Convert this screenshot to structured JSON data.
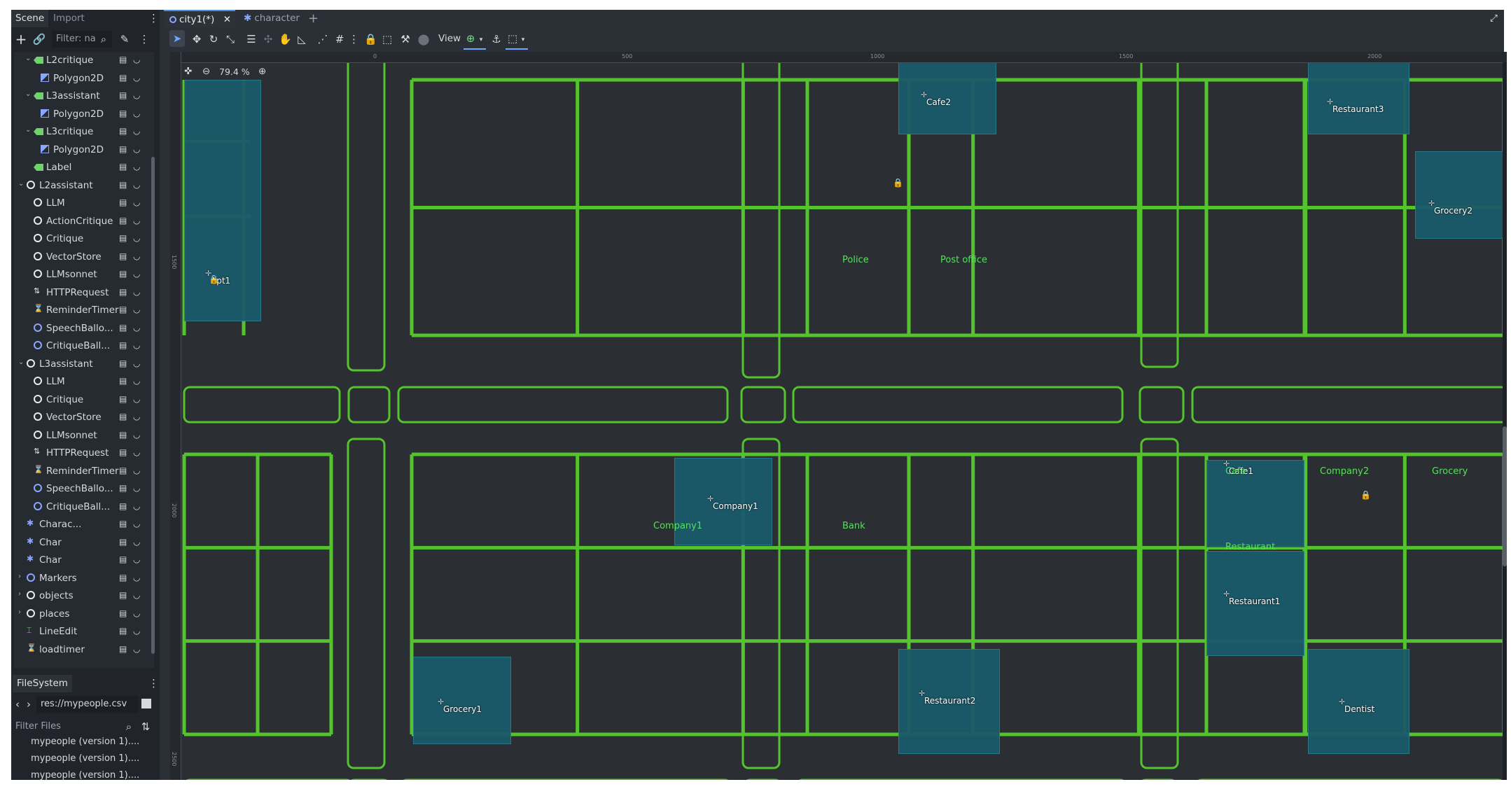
{
  "left_dock": {
    "tabs": [
      "Scene",
      "Import"
    ],
    "filter_placeholder": "Filter: na",
    "tree": [
      {
        "label": "L2critique",
        "depth": 2,
        "arrow": "v",
        "icon": "label-node-icon"
      },
      {
        "label": "Polygon2D",
        "depth": 3,
        "arrow": "",
        "icon": "polygon2d-icon"
      },
      {
        "label": "L3assistant",
        "depth": 2,
        "arrow": "v",
        "icon": "label-node-icon"
      },
      {
        "label": "Polygon2D",
        "depth": 3,
        "arrow": "",
        "icon": "polygon2d-icon"
      },
      {
        "label": "L3critique",
        "depth": 2,
        "arrow": "v",
        "icon": "label-node-icon"
      },
      {
        "label": "Polygon2D",
        "depth": 3,
        "arrow": "",
        "icon": "polygon2d-icon"
      },
      {
        "label": "Label",
        "depth": 2,
        "arrow": "",
        "icon": "label-node-icon"
      },
      {
        "label": "L2assistant",
        "depth": 1,
        "arrow": "v",
        "icon": "node-circle-icon"
      },
      {
        "label": "LLM",
        "depth": 2,
        "arrow": "",
        "icon": "node-circle-icon"
      },
      {
        "label": "ActionCritique",
        "depth": 2,
        "arrow": "",
        "icon": "node-circle-icon"
      },
      {
        "label": "Critique",
        "depth": 2,
        "arrow": "",
        "icon": "node-circle-icon"
      },
      {
        "label": "VectorStore",
        "depth": 2,
        "arrow": "",
        "icon": "node-circle-icon"
      },
      {
        "label": "LLMsonnet",
        "depth": 2,
        "arrow": "",
        "icon": "node-circle-icon"
      },
      {
        "label": "HTTPRequest",
        "depth": 2,
        "arrow": "",
        "icon": "http-icon"
      },
      {
        "label": "ReminderTimer",
        "depth": 2,
        "arrow": "",
        "icon": "timer-icon"
      },
      {
        "label": "SpeechBallo...",
        "depth": 2,
        "arrow": "",
        "icon": "node-circle-blue-icon"
      },
      {
        "label": "CritiqueBall...",
        "depth": 2,
        "arrow": "",
        "icon": "node-circle-blue-icon"
      },
      {
        "label": "L3assistant",
        "depth": 1,
        "arrow": "v",
        "icon": "node-circle-icon"
      },
      {
        "label": "LLM",
        "depth": 2,
        "arrow": "",
        "icon": "node-circle-icon"
      },
      {
        "label": "Critique",
        "depth": 2,
        "arrow": "",
        "icon": "node-circle-icon"
      },
      {
        "label": "VectorStore",
        "depth": 2,
        "arrow": "",
        "icon": "node-circle-icon"
      },
      {
        "label": "LLMsonnet",
        "depth": 2,
        "arrow": "",
        "icon": "node-circle-icon"
      },
      {
        "label": "HTTPRequest",
        "depth": 2,
        "arrow": "",
        "icon": "http-icon"
      },
      {
        "label": "ReminderTimer",
        "depth": 2,
        "arrow": "",
        "icon": "timer-icon"
      },
      {
        "label": "SpeechBallo...",
        "depth": 2,
        "arrow": "",
        "icon": "node-circle-blue-icon"
      },
      {
        "label": "CritiqueBall...",
        "depth": 2,
        "arrow": "",
        "icon": "node-circle-blue-icon"
      },
      {
        "label": "Charac...",
        "depth": 1,
        "arrow": "",
        "icon": "character-icon"
      },
      {
        "label": "Char",
        "depth": 1,
        "arrow": "",
        "icon": "character-icon"
      },
      {
        "label": "Char",
        "depth": 1,
        "arrow": "",
        "icon": "character-icon"
      },
      {
        "label": "Markers",
        "depth": 1,
        "arrow": ">",
        "icon": "node-circle-blue-icon"
      },
      {
        "label": "objects",
        "depth": 1,
        "arrow": ">",
        "icon": "node-circle-icon"
      },
      {
        "label": "places",
        "depth": 1,
        "arrow": ">",
        "icon": "node-circle-icon"
      },
      {
        "label": "LineEdit",
        "depth": 1,
        "arrow": "",
        "icon": "lineedit-icon"
      },
      {
        "label": "loadtimer",
        "depth": 1,
        "arrow": "",
        "icon": "timer-icon"
      }
    ],
    "filesystem": {
      "title": "FileSystem",
      "path": "res://mypeople.csv",
      "filter_placeholder": "Filter Files",
      "files": [
        "mypeople (version 1)....",
        "mypeople (version 1)....",
        "mypeople (version 1)...."
      ]
    }
  },
  "main": {
    "tabs": [
      {
        "label": "city1(*)",
        "icon": "scene-icon"
      },
      {
        "label": "character",
        "icon": "character-icon"
      }
    ],
    "toolbar_view_label": "View",
    "zoom": "79.4 %",
    "ruler_top": [
      "0",
      "500",
      "1000",
      "1500",
      "2000"
    ],
    "ruler_left": [
      "1500",
      "2000",
      "2500"
    ],
    "places": [
      {
        "name": "Cafe2"
      },
      {
        "name": "Restaurant3"
      },
      {
        "name": "Grocery2"
      },
      {
        "name": "Apt1"
      },
      {
        "name": "Company1"
      },
      {
        "name": "Cafe1"
      },
      {
        "name": "Restaurant1"
      },
      {
        "name": "Grocery1"
      },
      {
        "name": "Restaurant2"
      },
      {
        "name": "Dentist"
      }
    ],
    "map_labels": [
      "Police",
      "Post office",
      "Company1",
      "Bank",
      "Cafe",
      "Company2",
      "Grocery",
      "Restaurant"
    ],
    "colors": {
      "wall": "#55c32d",
      "place_fill": "#1a5a6a",
      "label_green": "#55e05a"
    }
  }
}
